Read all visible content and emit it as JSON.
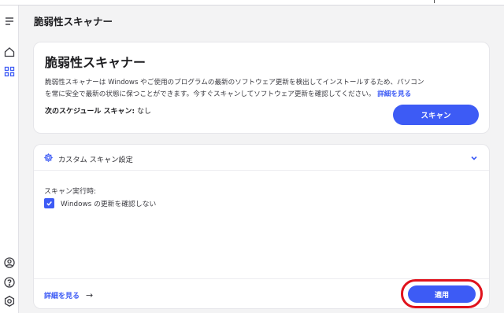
{
  "colors": {
    "accent": "#3d5bf5",
    "highlight": "#e0121c",
    "background": "#f3f3f4"
  },
  "sidebar": {
    "top_icons": [
      "menu-icon",
      "home-icon",
      "apps-icon"
    ],
    "bottom_icons": [
      "account-icon",
      "help-icon",
      "settings-icon"
    ],
    "active": "apps-icon"
  },
  "header": {
    "title": "脆弱性スキャナー"
  },
  "hero": {
    "title": "脆弱性スキャナー",
    "description_line1": "脆弱性スキャナーは Windows やご使用のプログラムの最新のソフトウェア更新を検出してインストールするため、パソコン",
    "description_line2": "を常に安全で最新の状態に保つことができます。今すぐスキャンしてソフトウェア更新を確認してください。",
    "learn_more": "詳細を見る",
    "schedule_label": "次のスケジュール スキャン:",
    "schedule_value": "なし",
    "scan_button": "スキャン"
  },
  "custom_scan": {
    "title": "カスタム スキャン設定",
    "exec_label": "スキャン実行時:",
    "checkbox_label": "Windows の更新を確認しない",
    "checkbox_checked": true,
    "learn_more": "詳細を見る",
    "arrow": "→",
    "apply_button": "適用"
  }
}
